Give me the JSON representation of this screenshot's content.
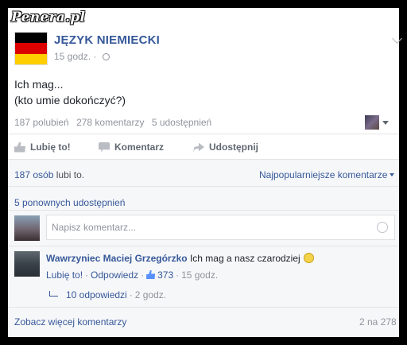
{
  "watermark": "Penera.pl",
  "post": {
    "page_name": "JĘZYK NIEMIECKI",
    "timestamp": "15 godz.",
    "text_line1": "Ich mag...",
    "text_line2": "(kto umie dokończyć?)",
    "flag_colors": [
      "#000000",
      "#dd0000",
      "#ffce00"
    ]
  },
  "stats": {
    "likes": "187 polubień",
    "comments": "278 komentarzy",
    "shares": "5 udostępnień"
  },
  "actions": {
    "like": "Lubię to!",
    "comment": "Komentarz",
    "share": "Udostępnij"
  },
  "summary": {
    "likes_people": "187 osób",
    "likes_suffix": "lubi to.",
    "sort": "Najpopularniejsze komentarze",
    "reshares": "5 ponownych udostępnień"
  },
  "composer": {
    "placeholder": "Napisz komentarz..."
  },
  "comment": {
    "author": "Wawrzyniec Maciej Grzegórzko",
    "text": "Ich mag a nasz czarodziej",
    "like": "Lubię to!",
    "reply": "Odpowiedz",
    "like_count": "373",
    "time": "15 godz."
  },
  "replies": {
    "label": "10 odpowiedzi",
    "time": "2 godz."
  },
  "footer": {
    "more": "Zobacz więcej komentarzy",
    "count": "2 na 278"
  },
  "colors": {
    "link": "#365899",
    "muted": "#90949c",
    "comments_bg": "#f6f7f9"
  }
}
